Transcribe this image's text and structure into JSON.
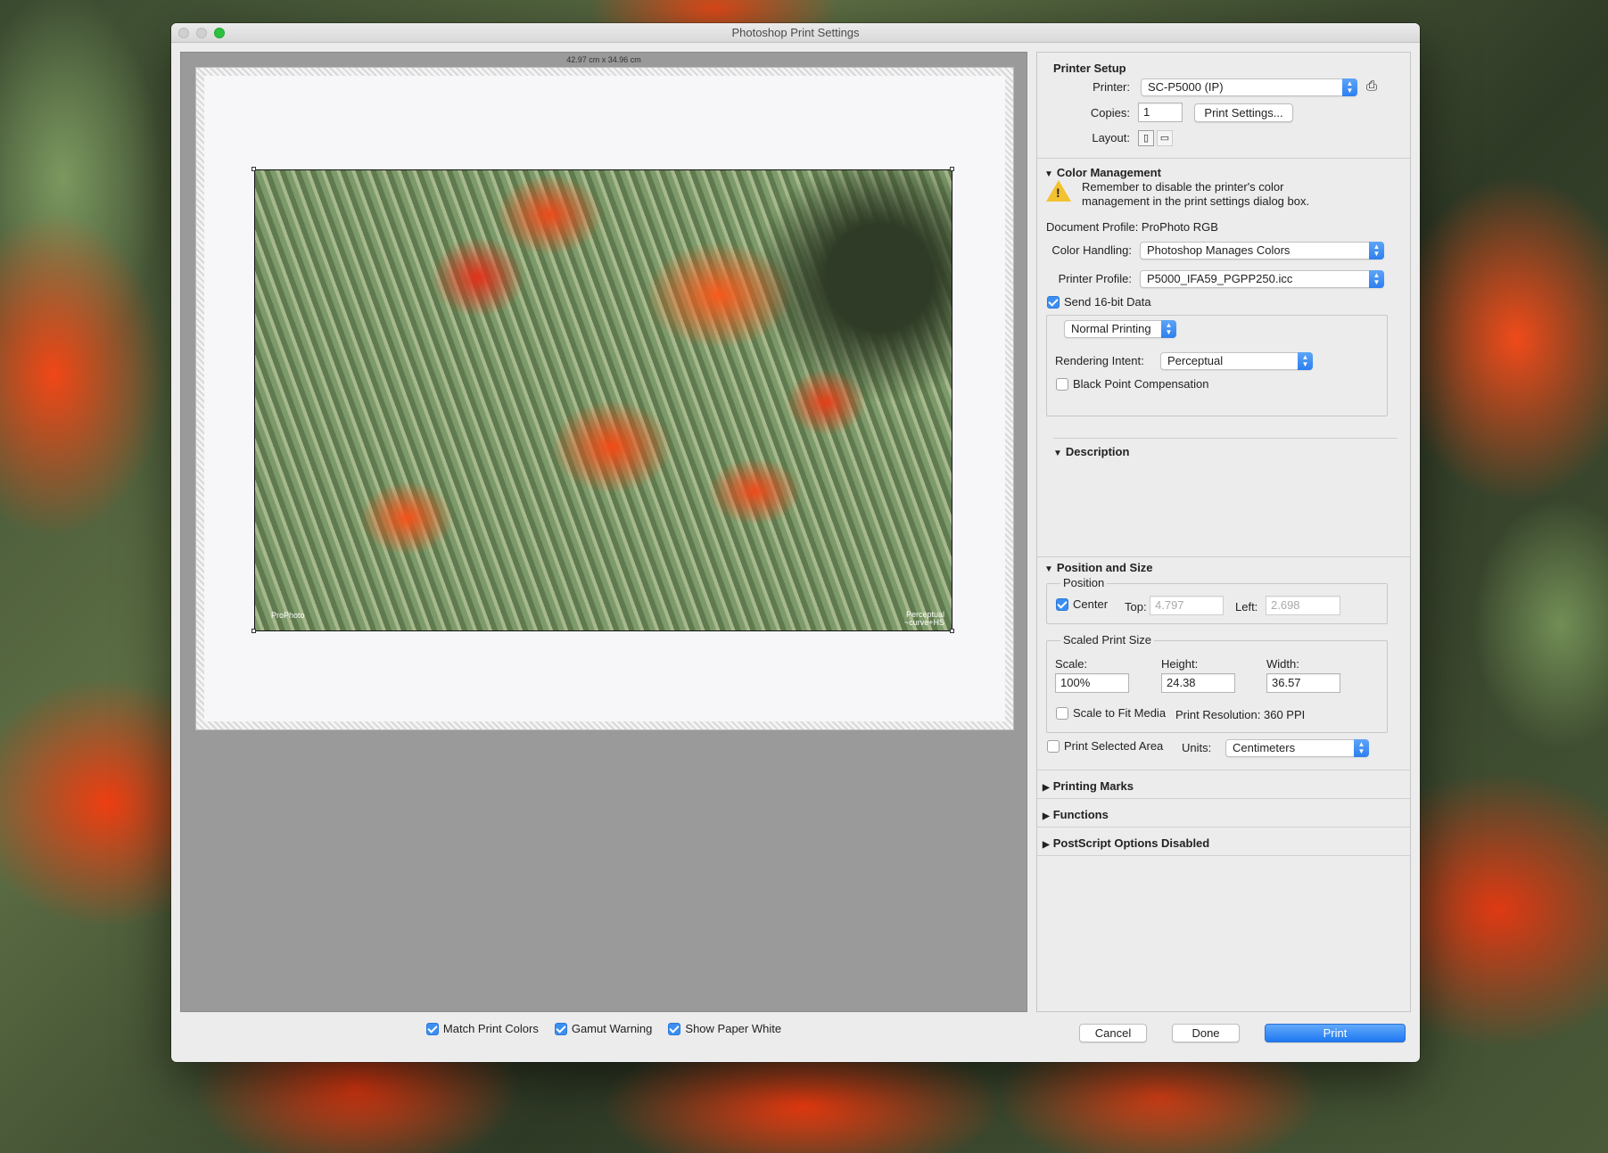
{
  "window": {
    "title": "Photoshop Print Settings"
  },
  "preview": {
    "paper_size": "42.97 cm x 34.96 cm",
    "photo_label_left": "ProPhoto",
    "photo_label_right_1": "Perceptual",
    "photo_label_right_2": "~curve+HS",
    "checks": [
      {
        "label": "Match Print Colors",
        "checked": true
      },
      {
        "label": "Gamut Warning",
        "checked": true
      },
      {
        "label": "Show Paper White",
        "checked": true
      }
    ]
  },
  "printer_setup": {
    "title": "Printer Setup",
    "printer_label": "Printer:",
    "printer_value": "SC-P5000 (IP)",
    "copies_label": "Copies:",
    "copies_value": "1",
    "print_settings_button": "Print Settings...",
    "layout_label": "Layout:"
  },
  "color_management": {
    "title": "Color Management",
    "warning": "Remember to disable the printer's color management in the print settings dialog box.",
    "warning_line1": "Remember to disable the printer's color",
    "warning_line2": "management in the print settings dialog box.",
    "document_profile": "Document Profile: ProPhoto RGB",
    "color_handling_label": "Color Handling:",
    "color_handling_value": "Photoshop Manages Colors",
    "printer_profile_label": "Printer Profile:",
    "printer_profile_value": "P5000_IFA59_PGPP250.icc",
    "send16_label": "Send 16-bit Data",
    "send16_checked": true,
    "printing_mode": "Normal Printing",
    "rendering_intent_label": "Rendering Intent:",
    "rendering_intent_value": "Perceptual",
    "bpc_label": "Black Point Compensation",
    "bpc_checked": false
  },
  "description": {
    "title": "Description"
  },
  "position_size": {
    "title": "Position and Size",
    "position_label": "Position",
    "center_label": "Center",
    "center_checked": true,
    "top_label": "Top:",
    "top_value": "4.797",
    "left_label": "Left:",
    "left_value": "2.698",
    "scaled_label": "Scaled Print Size",
    "scale_label": "Scale:",
    "scale_value": "100%",
    "height_label": "Height:",
    "height_value": "24.38",
    "width_label": "Width:",
    "width_value": "36.57",
    "scale_fit_label": "Scale to Fit Media",
    "scale_fit_checked": false,
    "resolution": "Print Resolution: 360 PPI",
    "print_selected_label": "Print Selected Area",
    "print_selected_checked": false,
    "units_label": "Units:",
    "units_value": "Centimeters"
  },
  "collapsed_sections": [
    "Printing Marks",
    "Functions",
    "PostScript Options Disabled"
  ],
  "footer": {
    "cancel": "Cancel",
    "done": "Done",
    "print": "Print"
  },
  "colors": {
    "accent": "#3b8ff3",
    "warning": "#f2c230"
  }
}
